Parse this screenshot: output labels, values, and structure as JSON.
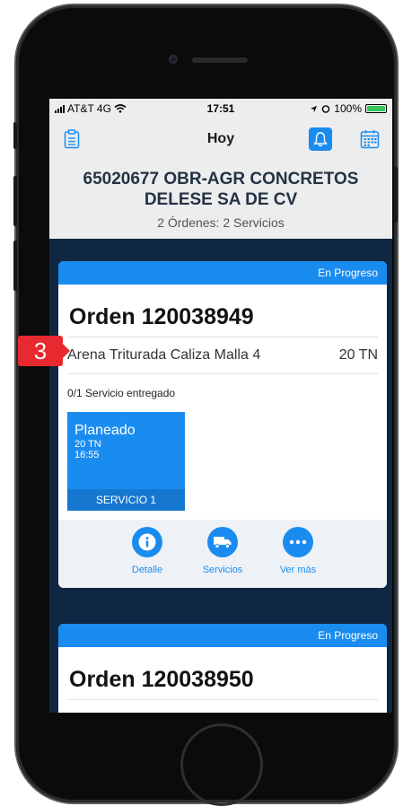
{
  "status_bar": {
    "carrier": "AT&T 4G",
    "time": "17:51",
    "battery": "100%"
  },
  "nav": {
    "title": "Hoy"
  },
  "header": {
    "title": "65020677 OBR-AGR CONCRETOS DELESE SA DE CV",
    "summary": "2 Órdenes: 2 Servicios"
  },
  "orders": [
    {
      "status": "En Progreso",
      "title": "Orden 120038949",
      "product": "Arena Triturada Caliza Malla 4",
      "quantity": "20 TN",
      "delivered": "0/1 Servicio entregado",
      "service": {
        "state": "Planeado",
        "qty": "20 TN",
        "time": "16:55",
        "label": "SERVICIO 1"
      },
      "actions": [
        "Detalle",
        "Servicios",
        "Ver más"
      ]
    },
    {
      "status": "En Progreso",
      "title": "Orden 120038950"
    }
  ],
  "annotation": {
    "number": "3"
  },
  "colors": {
    "accent": "#1a8cf0",
    "screen_bg": "#0f2743",
    "badge": "#e8292f"
  }
}
